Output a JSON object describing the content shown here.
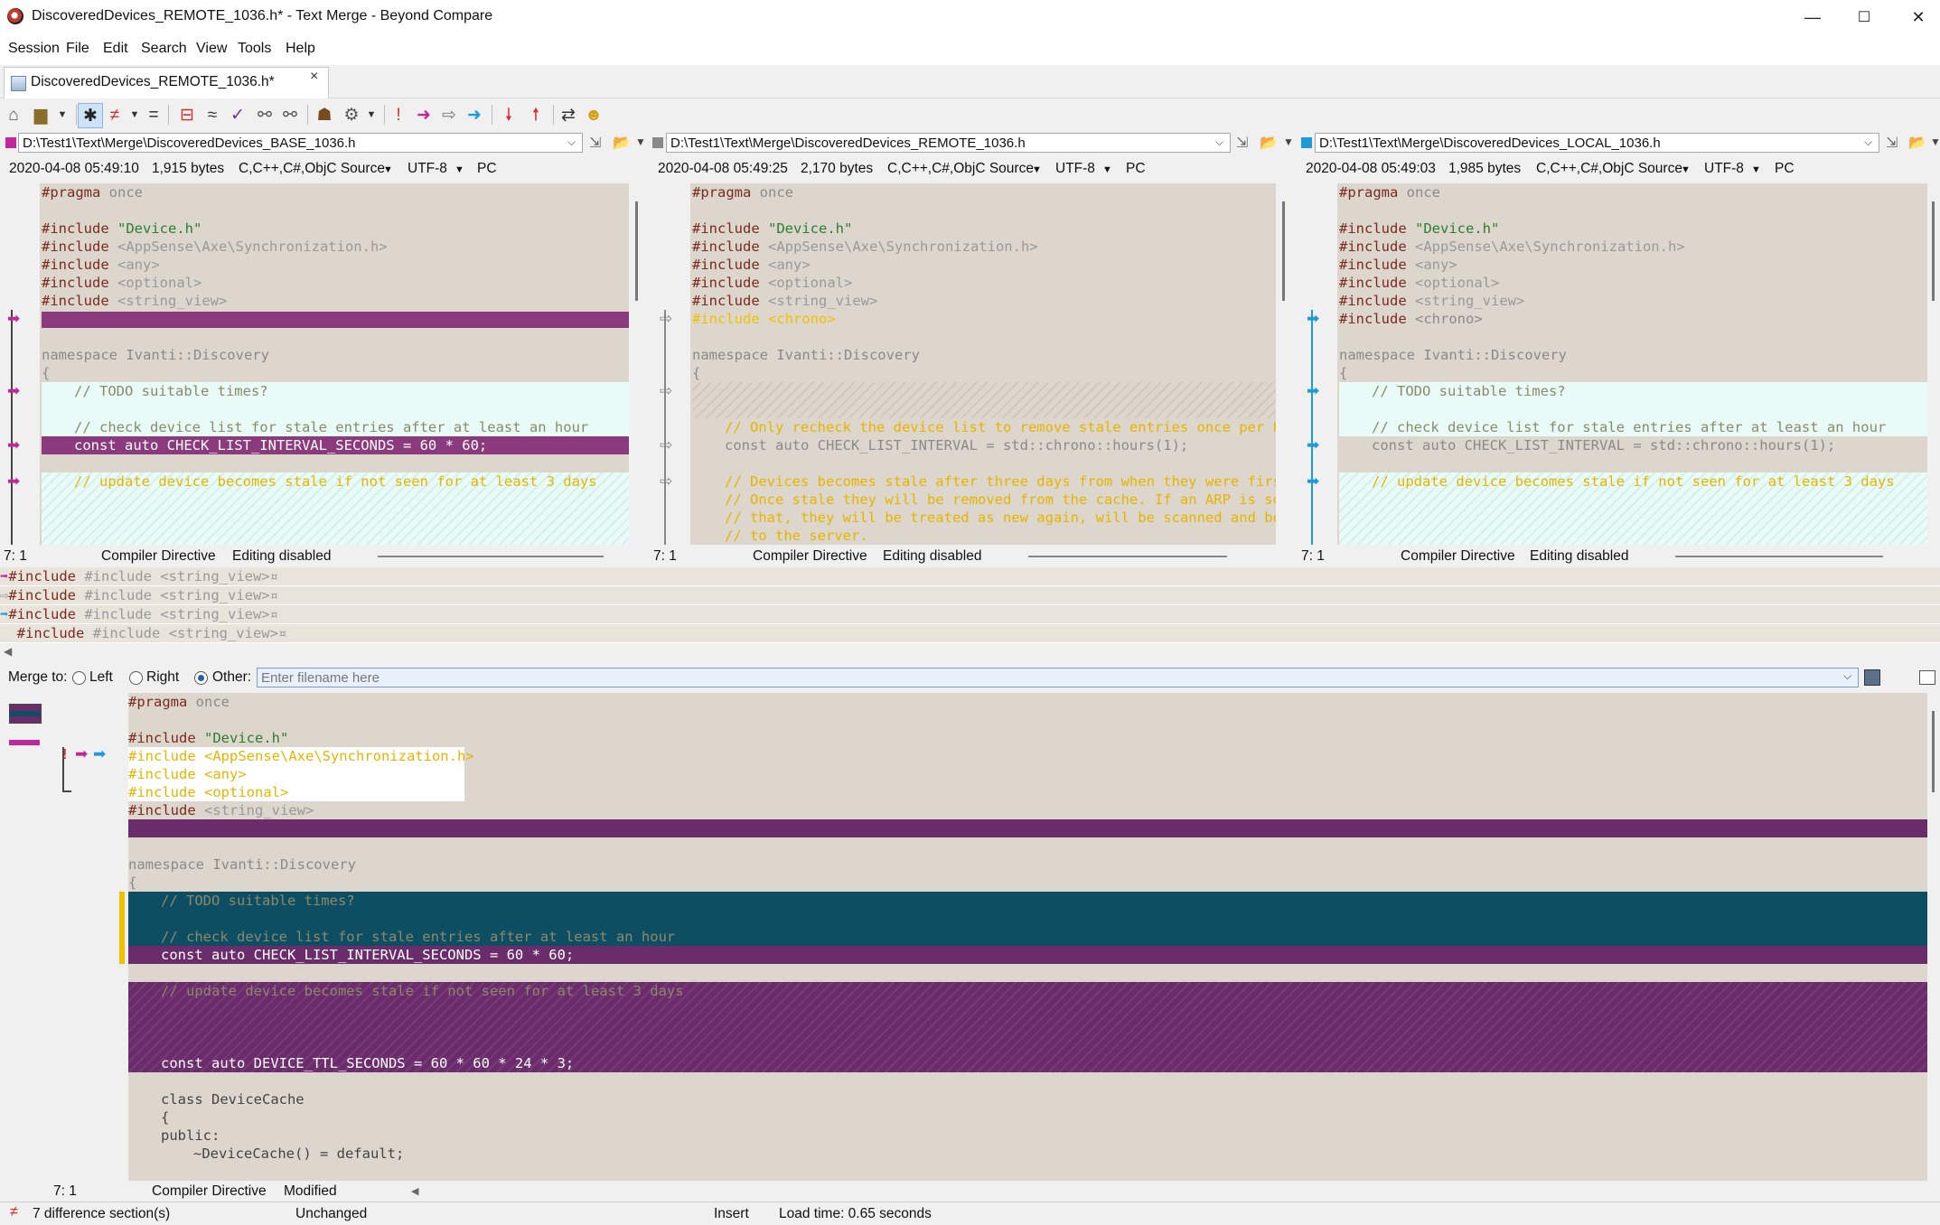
{
  "window": {
    "title": "DiscoveredDevices_REMOTE_1036.h* - Text Merge - Beyond Compare",
    "minimize": "—",
    "maximize": "☐",
    "close": "✕"
  },
  "menu": [
    "Session",
    "File",
    "Edit",
    "Search",
    "View",
    "Tools",
    "Help"
  ],
  "tab": {
    "label": "DiscoveredDevices_REMOTE_1036.h*",
    "close": "×"
  },
  "panes": [
    {
      "path": "D:\\Test1\\Text\\Merge\\DiscoveredDevices_BASE_1036.h",
      "swatch": "#c0279a",
      "timestamp": "2020-04-08 05:49:10",
      "size": "1,915 bytes",
      "format": "C,C++,C#,ObjC Source",
      "encoding": "UTF-8",
      "lineend": "PC",
      "pos": "7: 1",
      "section": "Compiler Directive",
      "edit": "Editing disabled"
    },
    {
      "path": "D:\\Test1\\Text\\Merge\\DiscoveredDevices_REMOTE_1036.h",
      "swatch": "#888888",
      "timestamp": "2020-04-08 05:49:25",
      "size": "2,170 bytes",
      "format": "C,C++,C#,ObjC Source",
      "encoding": "UTF-8",
      "lineend": "PC",
      "pos": "7: 1",
      "section": "Compiler Directive",
      "edit": "Editing disabled"
    },
    {
      "path": "D:\\Test1\\Text\\Merge\\DiscoveredDevices_LOCAL_1036.h",
      "swatch": "#1e9ad6",
      "timestamp": "2020-04-08 05:49:03",
      "size": "1,985 bytes",
      "format": "C,C++,C#,ObjC Source",
      "encoding": "UTF-8",
      "lineend": "PC",
      "pos": "7: 1",
      "section": "Compiler Directive",
      "edit": "Editing disabled"
    }
  ],
  "code": {
    "pragma": "#pragma",
    "once": "once",
    "include": "#include",
    "device_h": "\"Device.h\"",
    "sync": "<AppSense\\Axe\\Synchronization.h>",
    "any": "<any>",
    "optional": "<optional>",
    "string_view": "<string_view>",
    "chrono": "<chrono>",
    "namespace": "namespace Ivanti::Discovery",
    "brace": "{",
    "todo": "// TODO suitable times?",
    "check_hour": "// check device list for stale entries after at least an hour",
    "const_60": "const auto CHECK_LIST_INTERVAL_SECONDS = 60 * 60;",
    "const_chrono": "const auto CHECK_LIST_INTERVAL = std::chrono::hours(1);",
    "stale3": "// update device becomes stale if not seen for at least 3 days",
    "remote_c1": "// Only recheck the device list to remove stale entries once per hou",
    "remote_c2": "// Devices becomes stale after three days from when they were first",
    "remote_c3": "// Once stale they will be removed from the cache. If an ARP is seen",
    "remote_c4": "// that, they will be treated as new again, will be scanned and be t",
    "remote_c5": "// to the server.",
    "ttl": "const auto DEVICE_TTL_SECONDS = 60 * 60 * 24 * 3;",
    "class": "class DeviceCache",
    "public": "public:",
    "dtor": "~DeviceCache() = default;"
  },
  "line_compare": [
    "#include <string_view>¤",
    "#include <string_view>¤",
    "#include <string_view>¤",
    "#include <string_view>¤"
  ],
  "merge": {
    "label": "Merge to:",
    "left": "Left",
    "right": "Right",
    "other": "Other:",
    "placeholder": "Enter filename here"
  },
  "output_status": {
    "pos": "7: 1",
    "section": "Compiler Directive",
    "state": "Modified"
  },
  "status": {
    "diffs": "7 difference section(s)",
    "unchanged": "Unchanged",
    "mode": "Insert",
    "load": "Load time: 0.65 seconds"
  },
  "colors": {
    "base": "#c0279a",
    "local": "#1e9ad6",
    "conflict": "#6a2c6a",
    "change": "#0e4e63",
    "pane_bg": "#dcd6cc"
  }
}
